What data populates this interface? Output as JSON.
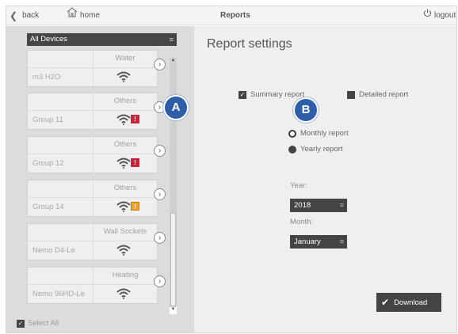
{
  "topbar": {
    "back_label": "back",
    "home_label": "home",
    "title": "Reports",
    "logout_label": "logout"
  },
  "device_list": {
    "header": "All Devices",
    "items": [
      {
        "type": "Water",
        "name": "m3 H2O",
        "badge": ""
      },
      {
        "type": "Others",
        "name": "Group 11",
        "badge": "!"
      },
      {
        "type": "Others",
        "name": "Group 12",
        "badge": "!"
      },
      {
        "type": "Others",
        "name": "Group 14",
        "badge": "!"
      },
      {
        "type": "Wall Sockets",
        "name": "Nemo D4-Le",
        "badge": ""
      },
      {
        "type": "Heating",
        "name": "Nemo 96HD-Le",
        "badge": ""
      }
    ],
    "select_all_label": "Select All"
  },
  "report_settings": {
    "title": "Report settings",
    "summary_label": "Summary report",
    "detailed_label": "Detailed report",
    "monthly_label": "Monthly report",
    "yearly_label": "Yearly report",
    "year_label": "Year:",
    "year_value": "2018",
    "month_label": "Month:",
    "month_value": "January",
    "download_label": "Download"
  },
  "markers": {
    "a": "A",
    "b": "B"
  },
  "colors": {
    "marker": "#2e5ea9",
    "alert_red": "#d21e3a",
    "alert_orange": "#f2a21c",
    "dark_control": "#444444"
  }
}
